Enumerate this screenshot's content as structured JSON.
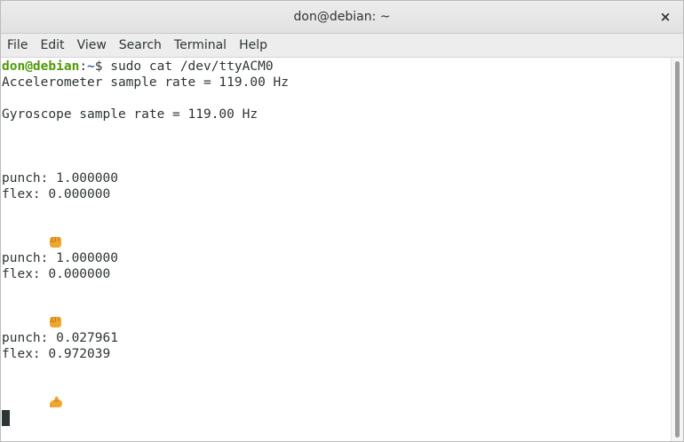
{
  "window": {
    "title": "don@debian: ~",
    "close_label": "×"
  },
  "menubar": {
    "items": [
      "File",
      "Edit",
      "View",
      "Search",
      "Terminal",
      "Help"
    ]
  },
  "terminal": {
    "prompt": {
      "user_host": "don@debian",
      "separator": ":",
      "path": "~",
      "symbol": "$",
      "command": " sudo cat /dev/ttyACM0"
    },
    "lines": {
      "accel": "Accelerometer sample rate = 119.00 Hz",
      "gyro": "Gyroscope sample rate = 119.00 Hz",
      "punch1": "punch: 1.000000",
      "flex1": "flex: 0.000000",
      "emoji1": "fist-emoji",
      "punch2": "punch: 1.000000",
      "flex2": "flex: 0.000000",
      "emoji2": "fist-emoji",
      "punch3": "punch: 0.027961",
      "flex3": "flex: 0.972039",
      "emoji3": "flexed-biceps-emoji"
    }
  },
  "colors": {
    "prompt_user": "#4e9a06",
    "prompt_path": "#3465a4",
    "text": "#2e3436",
    "emoji": "#f0a530"
  }
}
